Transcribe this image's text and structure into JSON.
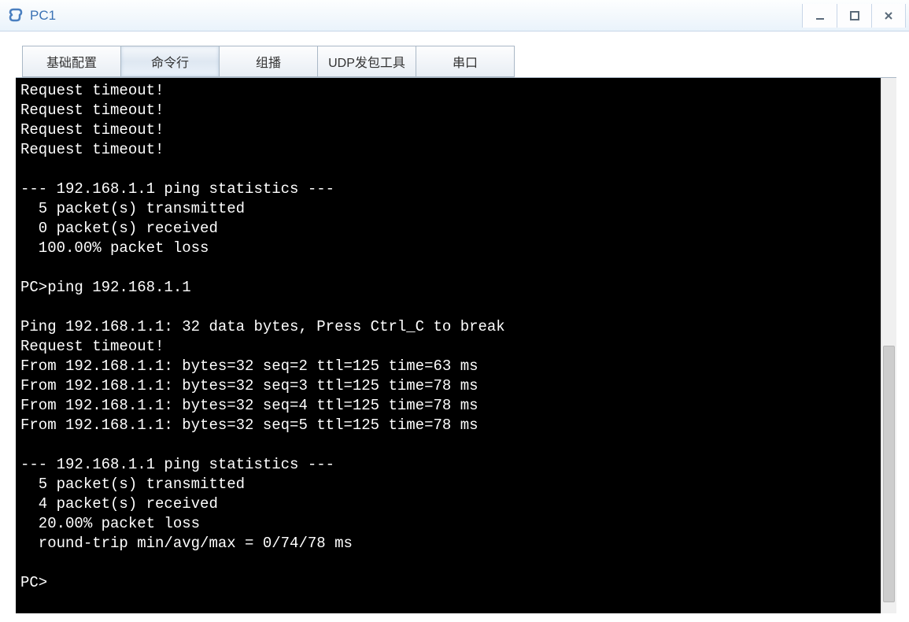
{
  "window": {
    "title": "PC1"
  },
  "tabs": [
    {
      "label": "基础配置"
    },
    {
      "label": "命令行"
    },
    {
      "label": "组播"
    },
    {
      "label": "UDP发包工具"
    },
    {
      "label": "串口"
    }
  ],
  "active_tab_index": 1,
  "terminal_lines": [
    "Request timeout!",
    "Request timeout!",
    "Request timeout!",
    "Request timeout!",
    "",
    "--- 192.168.1.1 ping statistics ---",
    "  5 packet(s) transmitted",
    "  0 packet(s) received",
    "  100.00% packet loss",
    "",
    "PC>ping 192.168.1.1",
    "",
    "Ping 192.168.1.1: 32 data bytes, Press Ctrl_C to break",
    "Request timeout!",
    "From 192.168.1.1: bytes=32 seq=2 ttl=125 time=63 ms",
    "From 192.168.1.1: bytes=32 seq=3 ttl=125 time=78 ms",
    "From 192.168.1.1: bytes=32 seq=4 ttl=125 time=78 ms",
    "From 192.168.1.1: bytes=32 seq=5 ttl=125 time=78 ms",
    "",
    "--- 192.168.1.1 ping statistics ---",
    "  5 packet(s) transmitted",
    "  4 packet(s) received",
    "  20.00% packet loss",
    "  round-trip min/avg/max = 0/74/78 ms",
    "",
    "PC>"
  ]
}
